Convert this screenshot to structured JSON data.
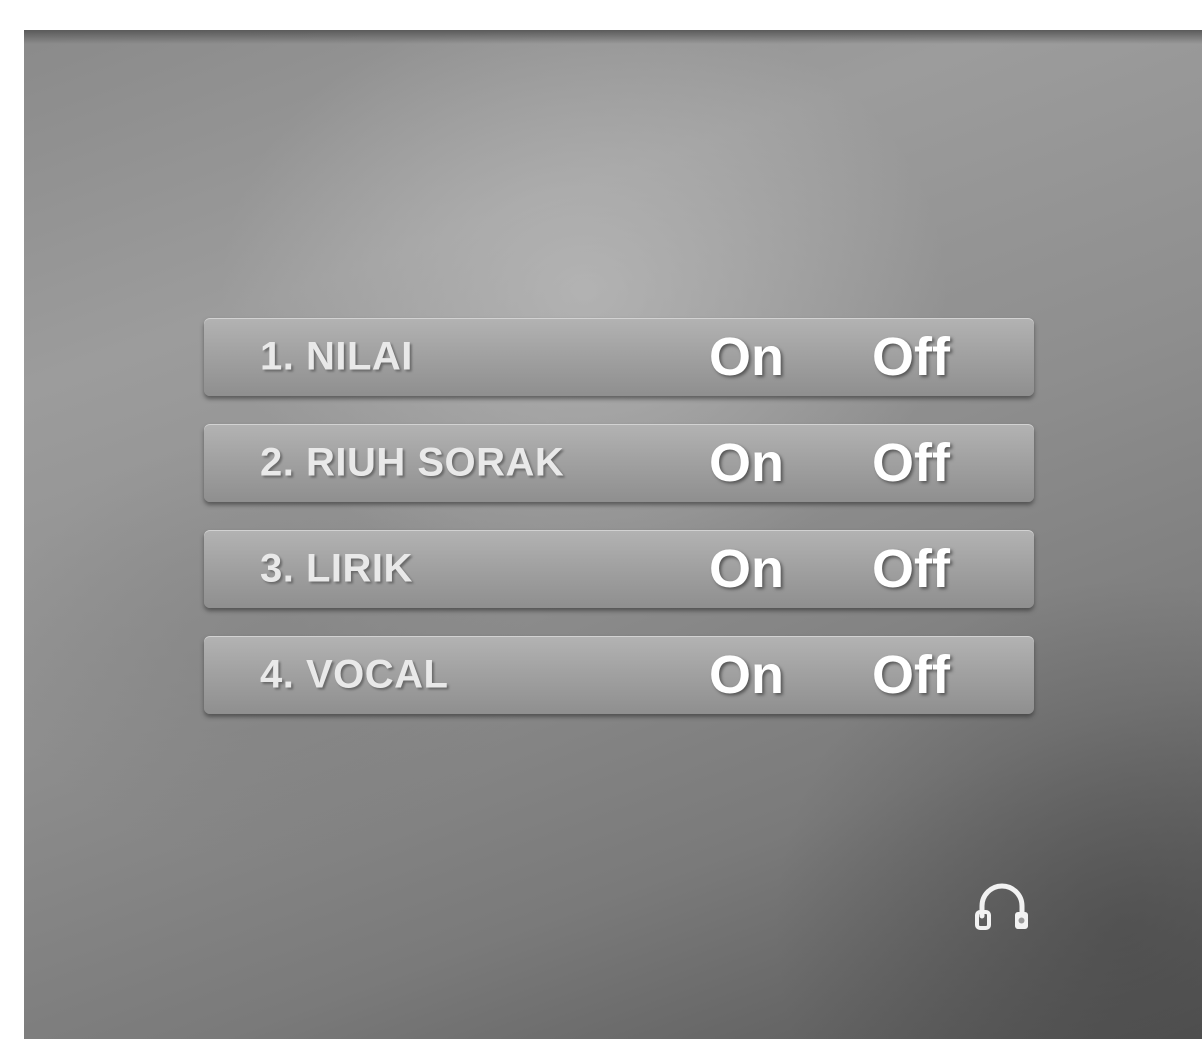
{
  "menu": {
    "items": [
      {
        "label": "1. NILAI",
        "on_label": "On",
        "off_label": "Off"
      },
      {
        "label": "2. RIUH SORAK",
        "on_label": "On",
        "off_label": "Off"
      },
      {
        "label": "3. LIRIK",
        "on_label": "On",
        "off_label": "Off"
      },
      {
        "label": "4. VOCAL",
        "on_label": "On",
        "off_label": "Off"
      }
    ]
  },
  "icons": {
    "corner": "headphone-icon"
  },
  "colors": {
    "background": "#8c8c8c",
    "row": "#a5a5a5",
    "text": "#ffffff"
  }
}
